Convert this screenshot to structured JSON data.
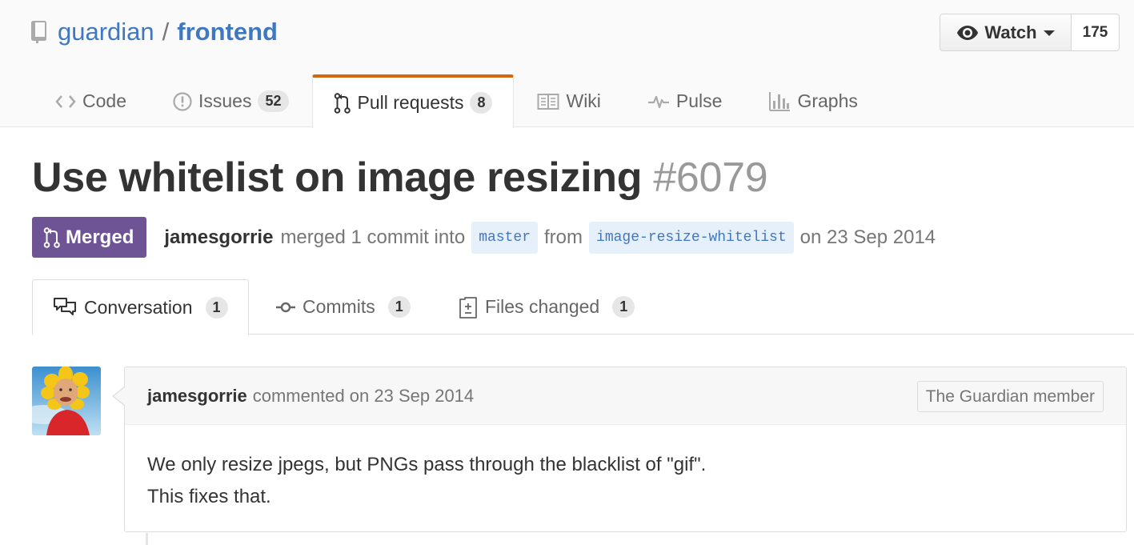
{
  "repo": {
    "owner": "guardian",
    "separator": "/",
    "name": "frontend"
  },
  "watch": {
    "label": "Watch",
    "count": "175"
  },
  "reponav": [
    {
      "label": "Code",
      "icon": "code-icon",
      "counter": null,
      "selected": false
    },
    {
      "label": "Issues",
      "icon": "issue-opened-icon",
      "counter": "52",
      "selected": false
    },
    {
      "label": "Pull requests",
      "icon": "git-pull-request-icon",
      "counter": "8",
      "selected": true
    },
    {
      "label": "Wiki",
      "icon": "book-icon",
      "counter": null,
      "selected": false
    },
    {
      "label": "Pulse",
      "icon": "pulse-icon",
      "counter": null,
      "selected": false
    },
    {
      "label": "Graphs",
      "icon": "graph-icon",
      "counter": null,
      "selected": false
    }
  ],
  "pr": {
    "title": "Use whitelist on image resizing",
    "number": "#6079",
    "state": "Merged",
    "author": "jamesgorrie",
    "merged_text": "merged 1 commit into",
    "base_branch": "master",
    "from_text": "from",
    "head_branch": "image-resize-whitelist",
    "date_text": "on 23 Sep 2014"
  },
  "tabs": [
    {
      "label": "Conversation",
      "icon": "comment-discussion-icon",
      "counter": "1",
      "selected": true
    },
    {
      "label": "Commits",
      "icon": "git-commit-icon",
      "counter": "1",
      "selected": false
    },
    {
      "label": "Files changed",
      "icon": "diff-icon",
      "counter": "1",
      "selected": false
    }
  ],
  "comment": {
    "author": "jamesgorrie",
    "meta": "commented on 23 Sep 2014",
    "label": "The Guardian member",
    "body_lines": [
      "We only resize jpegs, but PNGs pass through the blacklist of \"gif\".",
      "This fixes that."
    ]
  },
  "colors": {
    "link": "#4078c0",
    "merged": "#6e5494",
    "selected_tab_accent": "#d26911"
  }
}
